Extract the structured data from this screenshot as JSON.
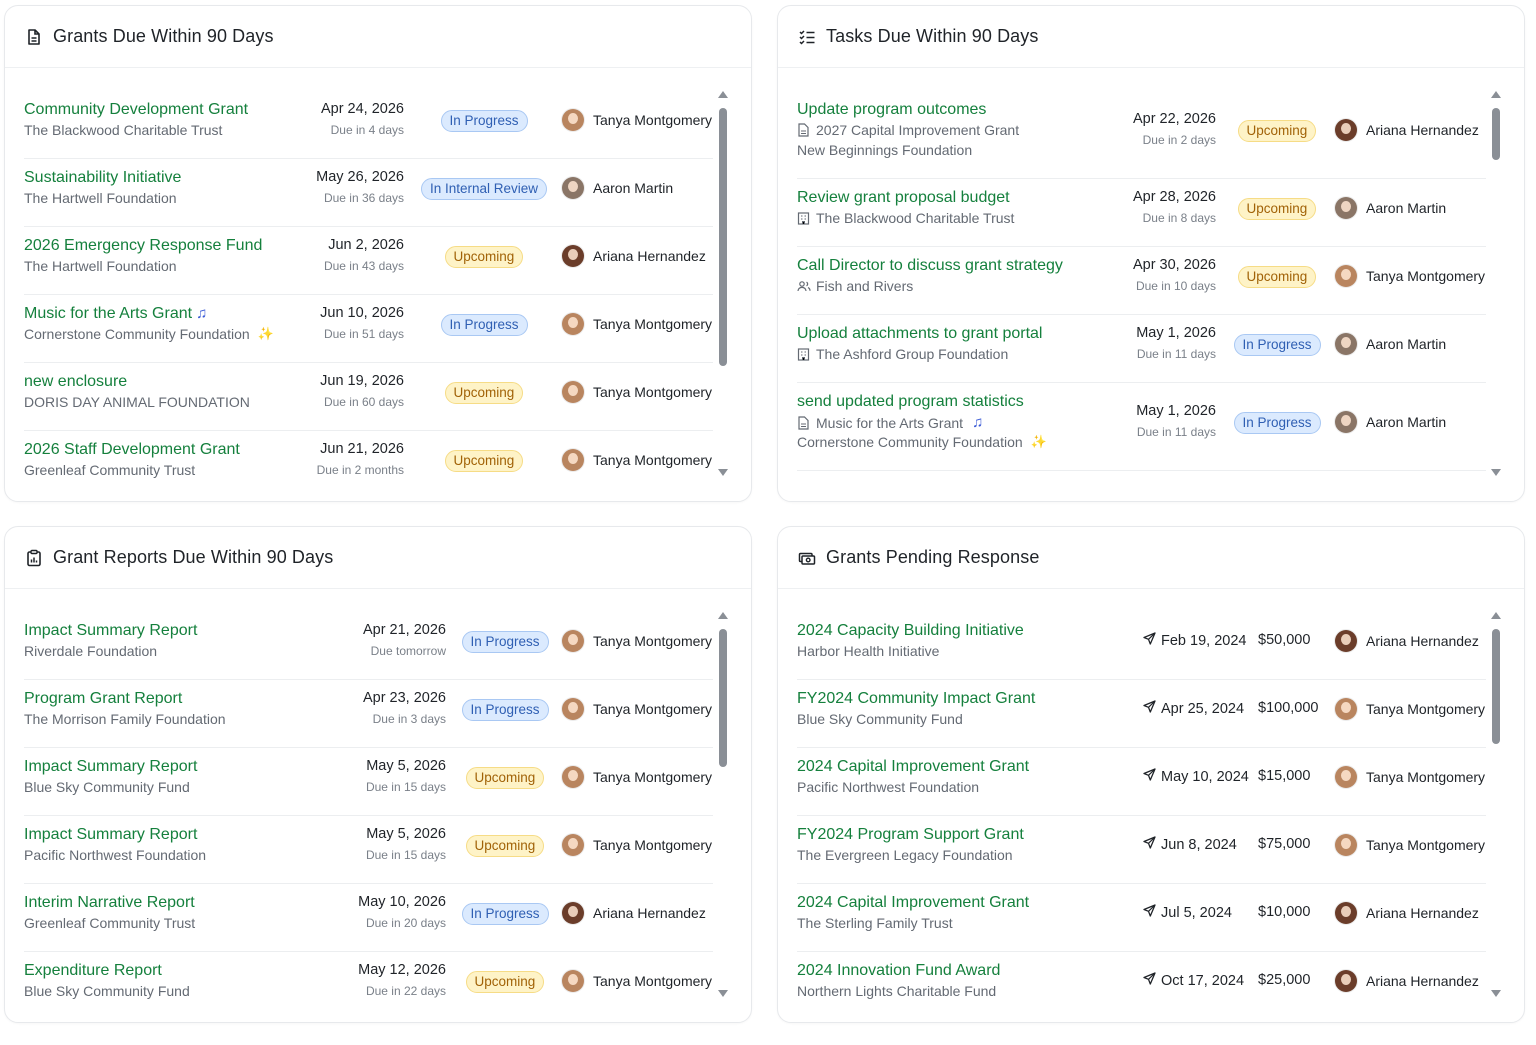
{
  "panels": {
    "grants": {
      "title": "Grants Due Within 90 Days",
      "rows": [
        {
          "title": "Community Development Grant",
          "sub": "The Blackwood Charitable Trust",
          "date": "Apr 24, 2026",
          "due": "Due in 4 days",
          "status": "In Progress",
          "person": "Tanya Montgomery"
        },
        {
          "title": "Sustainability Initiative",
          "sub": "The Hartwell Foundation",
          "date": "May 26, 2026",
          "due": "Due in 36 days",
          "status": "In Internal Review",
          "person": "Aaron Martin"
        },
        {
          "title": "2026 Emergency Response Fund",
          "sub": "The Hartwell Foundation",
          "date": "Jun 2, 2026",
          "due": "Due in 43 days",
          "status": "Upcoming",
          "person": "Ariana Hernandez"
        },
        {
          "title": "Music for the Arts Grant",
          "title_emoji": "♫",
          "sub": "Cornerstone Community Foundation",
          "sub_emoji": "✨",
          "date": "Jun 10, 2026",
          "due": "Due in 51 days",
          "status": "In Progress",
          "person": "Tanya Montgomery"
        },
        {
          "title": "new enclosure",
          "sub": "DORIS DAY ANIMAL FOUNDATION",
          "date": "Jun 19, 2026",
          "due": "Due in 60 days",
          "status": "Upcoming",
          "person": "Tanya Montgomery"
        },
        {
          "title": "2026 Staff Development Grant",
          "sub": "Greenleaf Community Trust",
          "date": "Jun 21, 2026",
          "due": "Due in 2 months",
          "status": "Upcoming",
          "person": "Tanya Montgomery"
        }
      ]
    },
    "tasks": {
      "title": "Tasks Due Within 90 Days",
      "rows": [
        {
          "title": "Update program outcomes",
          "sub_icon": "doc-icon",
          "sub": "2027 Capital Improvement Grant",
          "sub2": "New Beginnings Foundation",
          "date": "Apr 22, 2026",
          "due": "Due in 2 days",
          "status": "Upcoming",
          "person": "Ariana Hernandez"
        },
        {
          "title": "Review grant proposal budget",
          "sub_icon": "building-icon",
          "sub": "The Blackwood Charitable Trust",
          "date": "Apr 28, 2026",
          "due": "Due in 8 days",
          "status": "Upcoming",
          "person": "Aaron Martin"
        },
        {
          "title": "Call Director to discuss grant strategy",
          "sub_icon": "people-icon",
          "sub": "Fish and Rivers",
          "date": "Apr 30, 2026",
          "due": "Due in 10 days",
          "status": "Upcoming",
          "person": "Tanya Montgomery"
        },
        {
          "title": "Upload attachments to grant portal",
          "sub_icon": "building-icon",
          "sub": "The Ashford Group Foundation",
          "date": "May 1, 2026",
          "due": "Due in 11 days",
          "status": "In Progress",
          "person": "Aaron Martin"
        },
        {
          "title": "send updated program statistics",
          "sub_icon": "doc-icon",
          "sub": "Music for the Arts Grant",
          "sub_emoji": "♫",
          "sub2": "Cornerstone Community Foundation",
          "sub2_emoji": "✨",
          "date": "May 1, 2026",
          "due": "Due in 11 days",
          "status": "In Progress",
          "person": "Aaron Martin"
        }
      ]
    },
    "reports": {
      "title": "Grant Reports Due Within 90 Days",
      "rows": [
        {
          "title": "Impact Summary Report",
          "sub": "Riverdale Foundation",
          "date": "Apr 21, 2026",
          "due": "Due tomorrow",
          "status": "In Progress",
          "person": "Tanya Montgomery"
        },
        {
          "title": "Program Grant Report",
          "sub": "The Morrison Family Foundation",
          "date": "Apr 23, 2026",
          "due": "Due in 3 days",
          "status": "In Progress",
          "person": "Tanya Montgomery"
        },
        {
          "title": "Impact Summary Report",
          "sub": "Blue Sky Community Fund",
          "date": "May 5, 2026",
          "due": "Due in 15 days",
          "status": "Upcoming",
          "person": "Tanya Montgomery"
        },
        {
          "title": "Impact Summary Report",
          "sub": "Pacific Northwest Foundation",
          "date": "May 5, 2026",
          "due": "Due in 15 days",
          "status": "Upcoming",
          "person": "Tanya Montgomery"
        },
        {
          "title": "Interim Narrative Report",
          "sub": "Greenleaf Community Trust",
          "date": "May 10, 2026",
          "due": "Due in 20 days",
          "status": "In Progress",
          "person": "Ariana Hernandez"
        },
        {
          "title": "Expenditure Report",
          "sub": "Blue Sky Community Fund",
          "date": "May 12, 2026",
          "due": "Due in 22 days",
          "status": "Upcoming",
          "person": "Tanya Montgomery"
        }
      ]
    },
    "pending": {
      "title": "Grants Pending Response",
      "rows": [
        {
          "title": "2024 Capacity Building Initiative",
          "sub": "Harbor Health Initiative",
          "sent": "Feb 19, 2024",
          "amount": "$50,000",
          "person": "Ariana Hernandez"
        },
        {
          "title": "FY2024 Community Impact Grant",
          "sub": "Blue Sky Community Fund",
          "sent": "Apr 25, 2024",
          "amount": "$100,000",
          "person": "Tanya Montgomery"
        },
        {
          "title": "2024 Capital Improvement Grant",
          "sub": "Pacific Northwest Foundation",
          "sent": "May 10, 2024",
          "amount": "$15,000",
          "person": "Tanya Montgomery"
        },
        {
          "title": "FY2024 Program Support Grant",
          "sub": "The Evergreen Legacy Foundation",
          "sent": "Jun 8, 2024",
          "amount": "$75,000",
          "person": "Tanya Montgomery"
        },
        {
          "title": "2024 Capital Improvement Grant",
          "sub": "The Sterling Family Trust",
          "sent": "Jul 5, 2024",
          "amount": "$10,000",
          "person": "Ariana Hernandez"
        },
        {
          "title": "2024 Innovation Fund Award",
          "sub": "Northern Lights Charitable Fund",
          "sent": "Oct 17, 2024",
          "amount": "$25,000",
          "person": "Ariana Hernandez"
        }
      ]
    }
  },
  "avatars": {
    "Tanya Montgomery": "#b9855f",
    "Aaron Martin": "#8a7566",
    "Ariana Hernandez": "#6b3d2a"
  },
  "colors": {
    "link": "#15803d",
    "in_progress_bg": "#dbeafe",
    "upcoming_bg": "#fef3c7"
  }
}
